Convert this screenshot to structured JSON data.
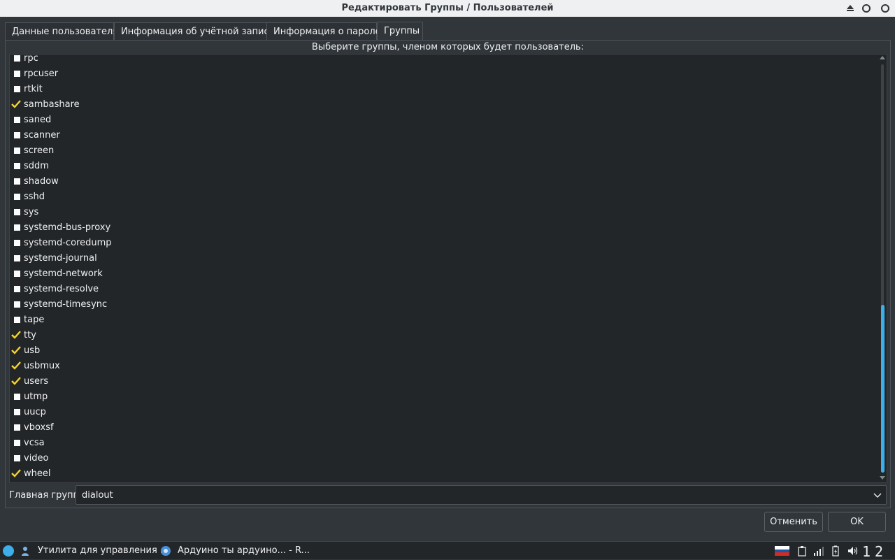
{
  "window": {
    "title": "Редактировать Группы / Пользователей"
  },
  "tabs": [
    {
      "label": "Данные пользователя",
      "active": false
    },
    {
      "label": "Информация об учётной записи",
      "active": false
    },
    {
      "label": "Информация о пароле",
      "active": false
    },
    {
      "label": "Группы",
      "active": true
    }
  ],
  "groups_panel": {
    "prompt": "Выберите группы, членом которых будет пользователь:",
    "items": [
      {
        "name": "rpc",
        "checked": false
      },
      {
        "name": "rpcuser",
        "checked": false
      },
      {
        "name": "rtkit",
        "checked": false
      },
      {
        "name": "sambashare",
        "checked": true
      },
      {
        "name": "saned",
        "checked": false
      },
      {
        "name": "scanner",
        "checked": false
      },
      {
        "name": "screen",
        "checked": false
      },
      {
        "name": "sddm",
        "checked": false
      },
      {
        "name": "shadow",
        "checked": false
      },
      {
        "name": "sshd",
        "checked": false
      },
      {
        "name": "sys",
        "checked": false
      },
      {
        "name": "systemd-bus-proxy",
        "checked": false
      },
      {
        "name": "systemd-coredump",
        "checked": false
      },
      {
        "name": "systemd-journal",
        "checked": false
      },
      {
        "name": "systemd-network",
        "checked": false
      },
      {
        "name": "systemd-resolve",
        "checked": false
      },
      {
        "name": "systemd-timesync",
        "checked": false
      },
      {
        "name": "tape",
        "checked": false
      },
      {
        "name": "tty",
        "checked": true
      },
      {
        "name": "usb",
        "checked": true
      },
      {
        "name": "usbmux",
        "checked": true
      },
      {
        "name": "users",
        "checked": true
      },
      {
        "name": "utmp",
        "checked": false
      },
      {
        "name": "uucp",
        "checked": false
      },
      {
        "name": "vboxsf",
        "checked": false
      },
      {
        "name": "vcsa",
        "checked": false
      },
      {
        "name": "video",
        "checked": false
      },
      {
        "name": "wheel",
        "checked": true
      }
    ],
    "primary_group_label": "Главная группа",
    "primary_group_value": "dialout"
  },
  "buttons": {
    "cancel": "Отменить",
    "ok": "OK"
  },
  "taskbar": {
    "task1": "Утилита для управления ...",
    "task2": "Ардуино ты ардуино... - R...",
    "clock": "12"
  },
  "colors": {
    "accent": "#3daee9",
    "check": "#f6d32d",
    "window_bg": "#31363b",
    "list_bg": "#232629"
  }
}
